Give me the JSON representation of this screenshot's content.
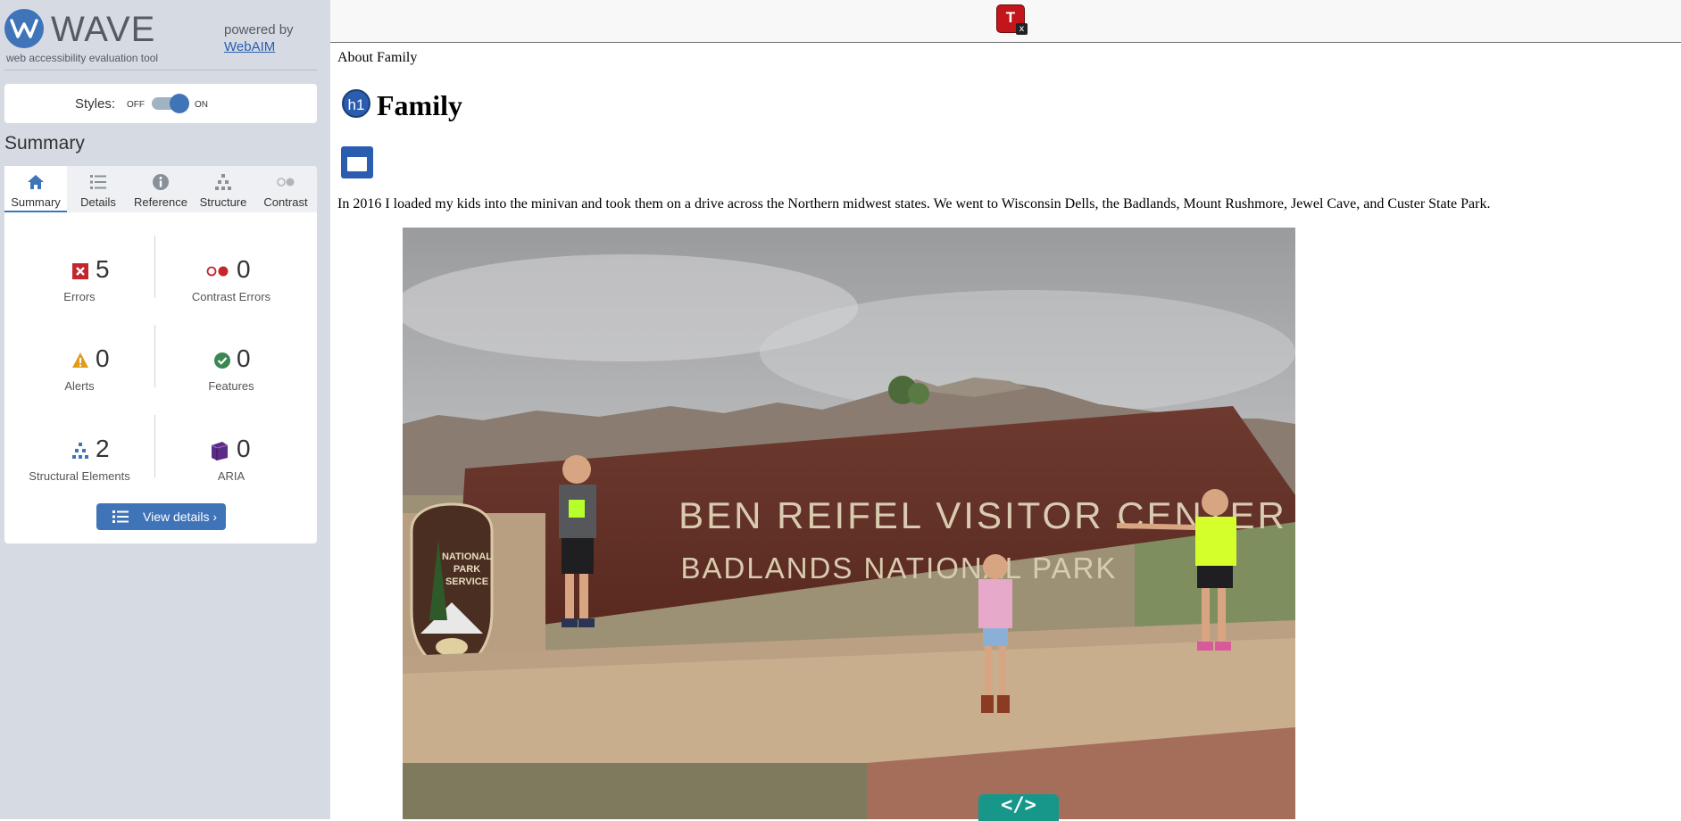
{
  "wave": {
    "logo_text": "WAVE",
    "tagline": "web accessibility evaluation tool",
    "powered_by": "powered by",
    "powered_link": "WebAIM"
  },
  "styles": {
    "label": "Styles:",
    "off": "OFF",
    "on": "ON",
    "state": "on"
  },
  "summary": {
    "heading": "Summary",
    "tabs": [
      {
        "label": "Summary",
        "icon": "home-icon",
        "active": true
      },
      {
        "label": "Details",
        "icon": "list-icon",
        "active": false
      },
      {
        "label": "Reference",
        "icon": "info-icon",
        "active": false
      },
      {
        "label": "Structure",
        "icon": "hierarchy-icon",
        "active": false
      },
      {
        "label": "Contrast",
        "icon": "contrast-icon",
        "active": false
      }
    ],
    "stats": {
      "errors": {
        "value": "5",
        "label": "Errors",
        "icon": "error-icon",
        "color": "#c4262e"
      },
      "contrast_errors": {
        "value": "0",
        "label": "Contrast Errors",
        "icon": "contrast-error-icon",
        "color": "#c4262e"
      },
      "alerts": {
        "value": "0",
        "label": "Alerts",
        "icon": "alert-icon",
        "color": "#e39b1b"
      },
      "features": {
        "value": "0",
        "label": "Features",
        "icon": "feature-icon",
        "color": "#3b8751"
      },
      "structural": {
        "value": "2",
        "label": "Structural Elements",
        "icon": "structure-icon",
        "color": "#3f74b8"
      },
      "aria": {
        "value": "0",
        "label": "ARIA",
        "icon": "aria-icon",
        "color": "#5b2d86"
      }
    },
    "view_details": "View details ›"
  },
  "toolbar": {
    "badge_letter": "T",
    "close_glyph": "x"
  },
  "page": {
    "breadcrumb": "About Family",
    "h1_badge": "h1",
    "title": "Family",
    "intro": "In 2016 I loaded my kids into the minivan and took them on a drive across the Northern midwest states. We went to Wisconsin Dells, the Badlands, Mount Rushmore, Jewel Cave, and Custer State Park.",
    "photo": {
      "sign_line1": "BEN REIFEL VISITOR CENTER",
      "sign_line2": "BADLANDS NATIONAL PARK",
      "shield_text1": "NATIONAL",
      "shield_text2": "PARK",
      "shield_text3": "SERVICE"
    },
    "code_badge": "</>"
  },
  "colors": {
    "accent": "#3f74b8",
    "sidebar_bg": "#d6dbe3",
    "error": "#c4262e",
    "code_badge": "#17968a"
  }
}
